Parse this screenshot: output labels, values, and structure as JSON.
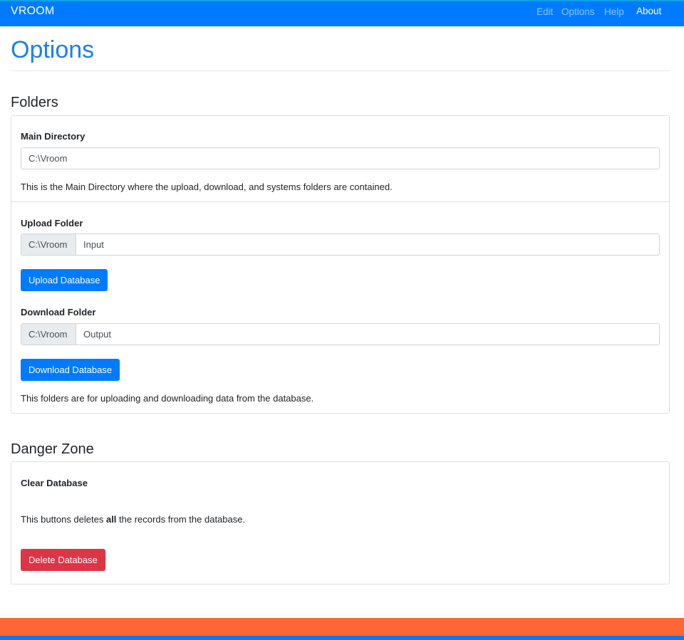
{
  "navbar": {
    "brand": "VROOM",
    "links": [
      {
        "label": "Edit",
        "active": false
      },
      {
        "label": "Options",
        "active": false
      },
      {
        "label": "Help",
        "active": false
      },
      {
        "label": "About",
        "active": true
      }
    ]
  },
  "page": {
    "title": "Options"
  },
  "folders": {
    "heading": "Folders",
    "main_directory": {
      "label": "Main Directory",
      "value": "C:\\Vroom",
      "help": "This is the Main Directory where the upload, download, and systems folders are contained."
    },
    "upload": {
      "label": "Upload Folder",
      "prefix": "C:\\Vroom",
      "value": "Input",
      "button": "Upload Database"
    },
    "download": {
      "label": "Download Folder",
      "prefix": "C:\\Vroom",
      "value": "Output",
      "button": "Download Database"
    },
    "help": "This folders are for uploading and downloading data from the database."
  },
  "danger_zone": {
    "heading": "Danger Zone",
    "label": "Clear Database",
    "help_before": "This buttons deletes ",
    "help_bold": "all",
    "help_after": " the records from the database.",
    "button": "Delete Database"
  },
  "colors": {
    "primary": "#007bff",
    "danger": "#dc3545",
    "footer_accent": "#ff6633",
    "title": "#1a80f0"
  }
}
